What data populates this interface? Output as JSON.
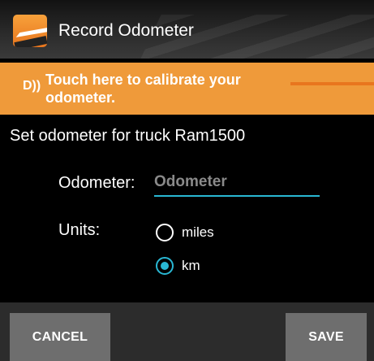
{
  "titlebar": {
    "title": "Record Odometer",
    "icon": "road-app-icon"
  },
  "banner": {
    "icon": "sound-wave-icon",
    "text": "Touch here to calibrate your odometer."
  },
  "form": {
    "heading": "Set odometer for truck Ram1500",
    "odometer_label": "Odometer:",
    "odometer_placeholder": "Odometer",
    "odometer_value": "",
    "units_label": "Units:",
    "units": [
      {
        "label": "miles",
        "selected": false
      },
      {
        "label": "km",
        "selected": true
      }
    ]
  },
  "footer": {
    "cancel_label": "CANCEL",
    "save_label": "SAVE"
  },
  "colors": {
    "accent": "#29b7d3",
    "banner": "#ef9a3a"
  }
}
